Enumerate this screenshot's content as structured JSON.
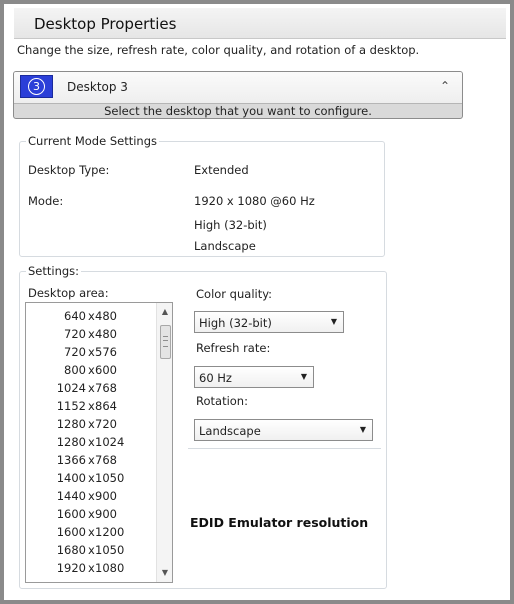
{
  "window": {
    "title": "Desktop Properties",
    "description": "Change the size, refresh rate, color quality, and rotation of a desktop."
  },
  "desktop_selector": {
    "number": "3",
    "label": "Desktop 3",
    "hint": "Select the desktop that you want to configure."
  },
  "current_mode": {
    "title": "Current Mode Settings",
    "type_label": "Desktop Type:",
    "type_value": "Extended",
    "mode_label": "Mode:",
    "mode_resolution": "1920 x 1080 @60 Hz",
    "mode_color": "High (32-bit)",
    "mode_rotation": "Landscape"
  },
  "settings": {
    "title": "Settings:",
    "desktop_area_label": "Desktop area:",
    "resolutions": [
      {
        "w": "640",
        "h": "480"
      },
      {
        "w": "720",
        "h": "480"
      },
      {
        "w": "720",
        "h": "576"
      },
      {
        "w": "800",
        "h": "600"
      },
      {
        "w": "1024",
        "h": "768"
      },
      {
        "w": "1152",
        "h": "864"
      },
      {
        "w": "1280",
        "h": "720"
      },
      {
        "w": "1280",
        "h": "1024"
      },
      {
        "w": "1366",
        "h": "768"
      },
      {
        "w": "1400",
        "h": "1050"
      },
      {
        "w": "1440",
        "h": "900"
      },
      {
        "w": "1600",
        "h": "900"
      },
      {
        "w": "1600",
        "h": "1200"
      },
      {
        "w": "1680",
        "h": "1050"
      },
      {
        "w": "1920",
        "h": "1080"
      }
    ],
    "color_quality_label": "Color quality:",
    "color_quality_value": "High (32-bit)",
    "refresh_rate_label": "Refresh rate:",
    "refresh_rate_value": "60 Hz",
    "rotation_label": "Rotation:",
    "rotation_value": "Landscape"
  },
  "annotation": "EDID Emulator resolution",
  "icons": {
    "chevron": "⌃",
    "dropdown": "▼",
    "scroll_up": "▲",
    "scroll_down": "▼",
    "times": "x"
  },
  "colors": {
    "accent_blue": "#2b3fd8",
    "frame_gray": "#8a8a8a",
    "group_border": "#d6dbe0"
  }
}
